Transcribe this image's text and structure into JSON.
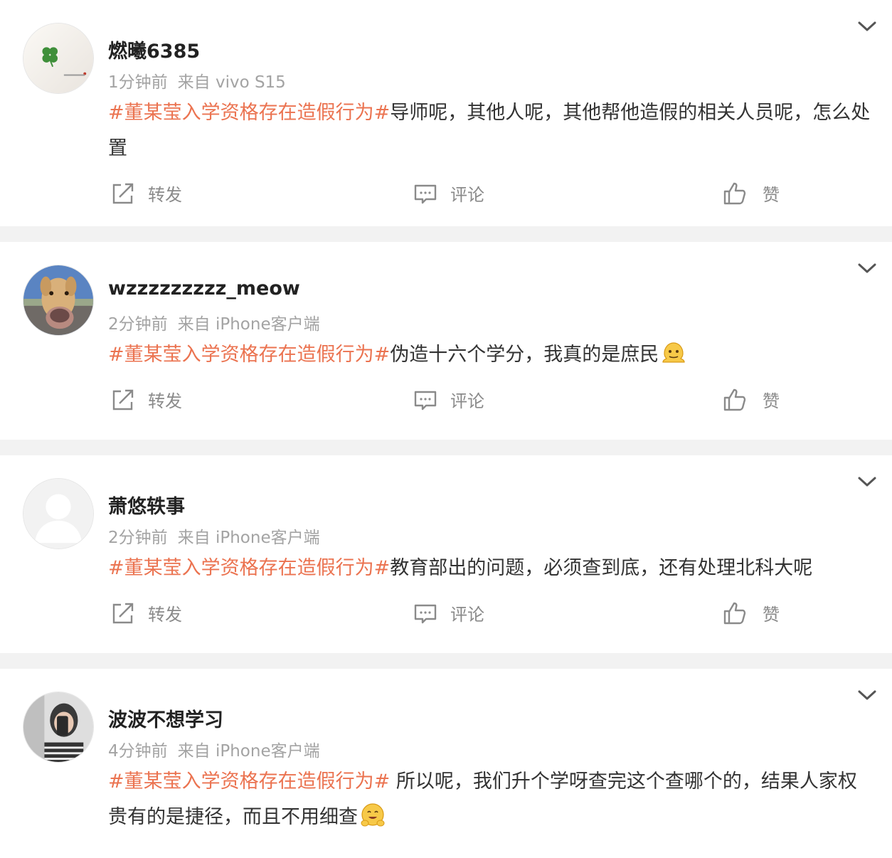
{
  "posts": [
    {
      "username": "燃曦6385",
      "time": "1分钟前",
      "source": "来自 vivo S15",
      "topic": "#董某莹入学资格存在造假行为#",
      "text": "导师呢，其他人呢，其他帮他造假的相关人员呢，怎么处置",
      "emoji": "",
      "avatar": "clover-avatar",
      "repost_label": "转发",
      "comment_label": "评论",
      "like_label": "赞"
    },
    {
      "username": "wzzzzzzzzz_meow",
      "time": "2分钟前",
      "source": "来自 iPhone客户端",
      "topic": "#董某莹入学资格存在造假行为#",
      "text": "伪造十六个学分，我真的是庶民",
      "emoji": "melting-face-emoji",
      "avatar": "dog-avatar",
      "repost_label": "转发",
      "comment_label": "评论",
      "like_label": "赞"
    },
    {
      "username": "萧悠轶事",
      "time": "2分钟前",
      "source": "来自 iPhone客户端",
      "topic": "#董某莹入学资格存在造假行为#",
      "text": "教育部出的问题，必须查到底，还有处理北科大呢",
      "emoji": "",
      "avatar": "default-avatar",
      "repost_label": "转发",
      "comment_label": "评论",
      "like_label": "赞"
    },
    {
      "username": "波波不想学习",
      "time": "4分钟前",
      "source": "来自 iPhone客户端",
      "topic": "#董某莹入学资格存在造假行为#",
      "text": " 所以呢，我们升个学呀查完这个查哪个的，结果人家权贵有的是捷径，而且不用细查",
      "emoji": "hugging-face-emoji",
      "avatar": "selfie-avatar",
      "repost_label": "转发",
      "comment_label": "评论",
      "like_label": "赞"
    }
  ],
  "colors": {
    "topic": "#eb7350",
    "meta": "#a3a3a3",
    "separator": "#f2f2f2"
  }
}
